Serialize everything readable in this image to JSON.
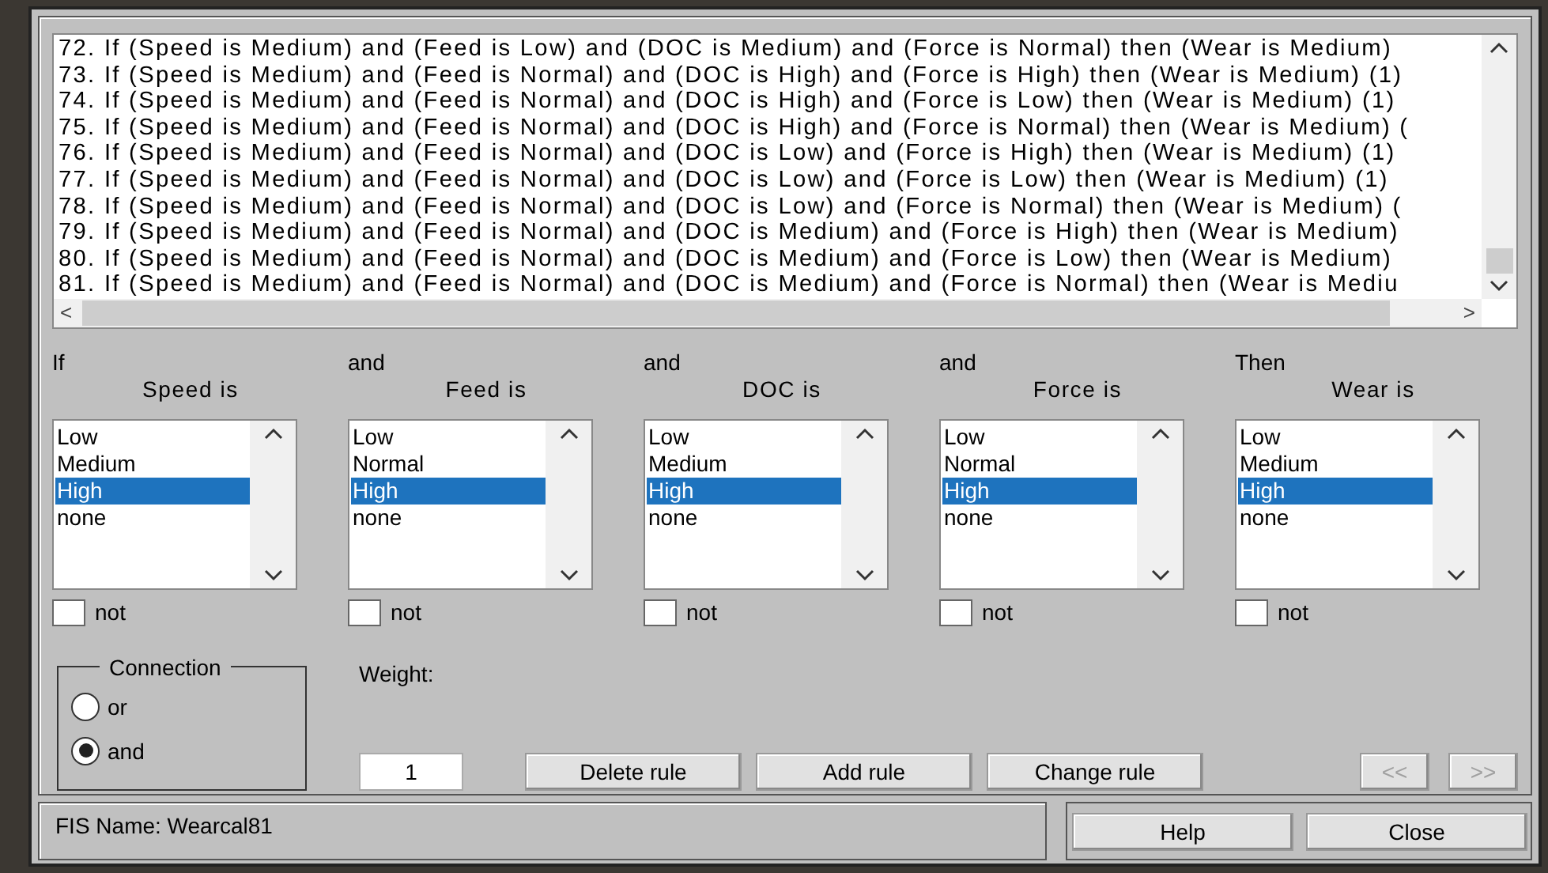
{
  "rules": [
    "72. If (Speed is Medium) and (Feed is Low) and (DOC is Medium) and (Force is Normal) then (Wear is Medium)",
    "73. If (Speed is Medium) and (Feed is Normal) and (DOC is High) and (Force is High) then (Wear is Medium) (1)",
    "74. If (Speed is Medium) and (Feed is Normal) and (DOC is High) and (Force is Low) then (Wear is Medium) (1)",
    "75. If (Speed is Medium) and (Feed is Normal) and (DOC is High) and (Force is Normal) then (Wear is Medium) (",
    "76. If (Speed is Medium) and (Feed is Normal) and (DOC is Low) and (Force is High) then (Wear is Medium) (1)",
    "77. If (Speed is Medium) and (Feed is Normal) and (DOC is Low) and (Force is Low) then (Wear is Medium) (1)",
    "78. If (Speed is Medium) and (Feed is Normal) and (DOC is Low) and (Force is Normal) then (Wear is Medium) (",
    "79. If (Speed is Medium) and (Feed is Normal) and (DOC is Medium) and (Force is High) then (Wear is Medium)",
    "80. If (Speed is Medium) and (Feed is Normal) and (DOC is Medium) and (Force is Low) then (Wear is Medium)",
    "81. If (Speed is Medium) and (Feed is Normal) and (DOC is Medium) and (Force is Normal) then (Wear is Mediu"
  ],
  "scroll_left": "<",
  "scroll_right": ">",
  "variables": [
    {
      "connector": "If",
      "label": "Speed is",
      "options": [
        {
          "label": "Low",
          "selected": false
        },
        {
          "label": "Medium",
          "selected": false
        },
        {
          "label": "High",
          "selected": true
        },
        {
          "label": "none",
          "selected": false
        }
      ],
      "not": {
        "label": "not",
        "checked": false
      }
    },
    {
      "connector": "and",
      "label": "Feed is",
      "options": [
        {
          "label": "Low",
          "selected": false
        },
        {
          "label": "Normal",
          "selected": false
        },
        {
          "label": "High",
          "selected": true
        },
        {
          "label": "none",
          "selected": false
        }
      ],
      "not": {
        "label": "not",
        "checked": false
      }
    },
    {
      "connector": "and",
      "label": "DOC is",
      "options": [
        {
          "label": "Low",
          "selected": false
        },
        {
          "label": "Medium",
          "selected": false
        },
        {
          "label": "High",
          "selected": true
        },
        {
          "label": "none",
          "selected": false
        }
      ],
      "not": {
        "label": "not",
        "checked": false
      }
    },
    {
      "connector": "and",
      "label": "Force is",
      "options": [
        {
          "label": "Low",
          "selected": false
        },
        {
          "label": "Normal",
          "selected": false
        },
        {
          "label": "High",
          "selected": true
        },
        {
          "label": "none",
          "selected": false
        }
      ],
      "not": {
        "label": "not",
        "checked": false
      }
    },
    {
      "connector": "Then",
      "label": "Wear is",
      "options": [
        {
          "label": "Low",
          "selected": false
        },
        {
          "label": "Medium",
          "selected": false
        },
        {
          "label": "High",
          "selected": true
        },
        {
          "label": "none",
          "selected": false
        }
      ],
      "not": {
        "label": "not",
        "checked": false
      }
    }
  ],
  "connection": {
    "title": "Connection",
    "options": [
      {
        "label": "or",
        "selected": false
      },
      {
        "label": "and",
        "selected": true
      }
    ]
  },
  "weight": {
    "label": "Weight:",
    "value": "1"
  },
  "rule_buttons": [
    {
      "label": "Delete rule",
      "disabled": false
    },
    {
      "label": "Add rule",
      "disabled": false
    },
    {
      "label": "Change rule",
      "disabled": false
    }
  ],
  "nav_buttons": [
    {
      "label": "<<",
      "disabled": true
    },
    {
      "label": ">>",
      "disabled": true
    }
  ],
  "status": "FIS Name: Wearcal81",
  "footer_buttons": [
    {
      "label": "Help",
      "disabled": false
    },
    {
      "label": "Close",
      "disabled": false
    }
  ]
}
